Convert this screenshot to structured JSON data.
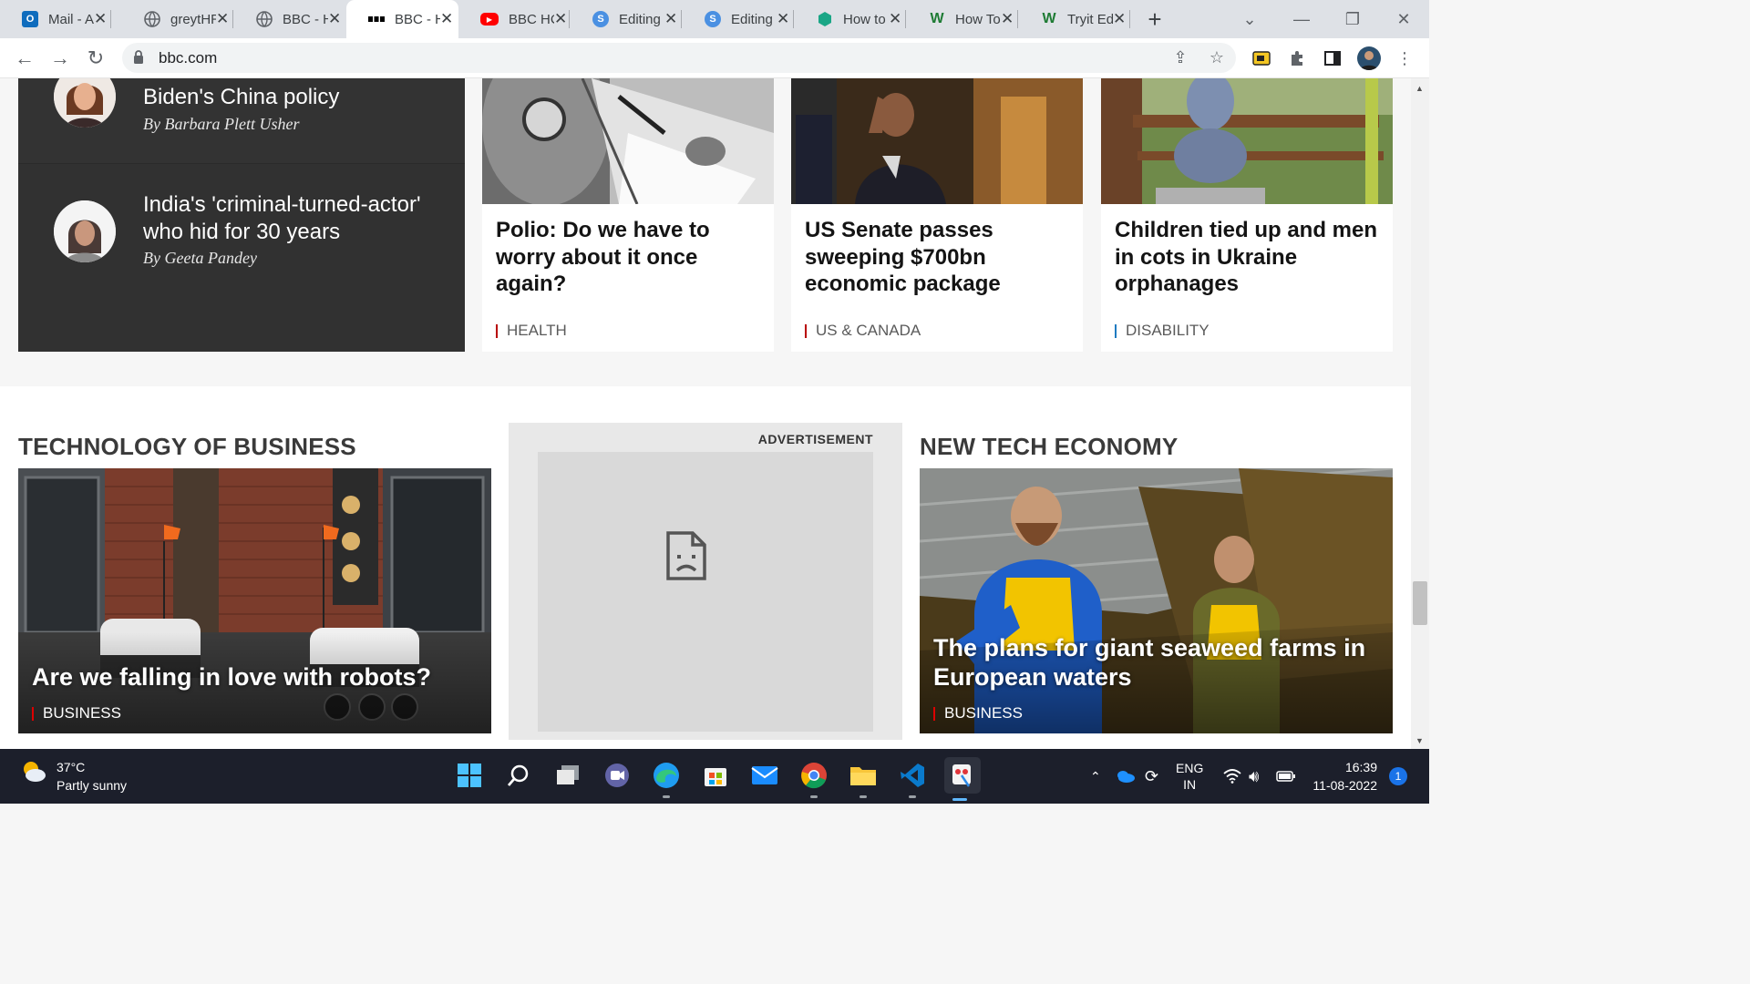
{
  "browser": {
    "tabs": [
      {
        "title": "Mail - A",
        "favicon": "outlook-icon",
        "color": "#0f6cbd",
        "glyph": "O"
      },
      {
        "title": "greytHR",
        "favicon": "globe-icon",
        "color": "#5f6368",
        "glyph": ""
      },
      {
        "title": "BBC - H",
        "favicon": "globe-icon",
        "color": "#5f6368",
        "glyph": ""
      },
      {
        "title": "BBC - H",
        "favicon": "bbc-icon",
        "color": "#000000",
        "glyph": "",
        "active": true
      },
      {
        "title": "BBC HC",
        "favicon": "youtube-icon",
        "color": "#ff0000",
        "glyph": "▶"
      },
      {
        "title": "Editing",
        "favicon": "editor-icon",
        "color": "#4a90e2",
        "glyph": "S"
      },
      {
        "title": "Editing",
        "favicon": "editor-icon",
        "color": "#4a90e2",
        "glyph": "S"
      },
      {
        "title": "How to",
        "favicon": "shield-icon",
        "color": "#1aa686",
        "glyph": ""
      },
      {
        "title": "How To",
        "favicon": "wikihow-icon",
        "color": "#1e7b34",
        "glyph": "W"
      },
      {
        "title": "Tryit Ed",
        "favicon": "wikihow-icon",
        "color": "#1e7b34",
        "glyph": "W"
      }
    ],
    "url": "bbc.com"
  },
  "top_stories": {
    "dark_items": [
      {
        "title": "Biden's China policy",
        "byline": "By Barbara Plett Usher"
      },
      {
        "title": "India's 'criminal-turned-actor' who hid for 30 years",
        "byline": "By Geeta Pandey"
      }
    ],
    "cards": [
      {
        "headline": "Polio: Do we have to worry about it once again?",
        "tag": "HEALTH",
        "tag_color": "#b80000"
      },
      {
        "headline": "US Senate passes sweeping $700bn economic package",
        "tag": "US & CANADA",
        "tag_color": "#b80000"
      },
      {
        "headline": "Children tied up and men in cots in Ukraine orphanages",
        "tag": "DISABILITY",
        "tag_color": "#1f7bc1"
      }
    ]
  },
  "tech_of_business": {
    "title": "TECHNOLOGY OF BUSINESS",
    "headline": "Are we falling in love with robots?",
    "tag": "BUSINESS"
  },
  "advertisement": {
    "label": "ADVERTISEMENT"
  },
  "new_tech_economy": {
    "title": "NEW TECH ECONOMY",
    "headline": "The plans for giant seaweed farms in European waters",
    "tag": "BUSINESS"
  },
  "taskbar": {
    "weather_temp": "37°C",
    "weather_desc": "Partly sunny",
    "lang_line1": "ENG",
    "lang_line2": "IN",
    "time": "16:39",
    "date": "11-08-2022",
    "notification_count": "1"
  }
}
